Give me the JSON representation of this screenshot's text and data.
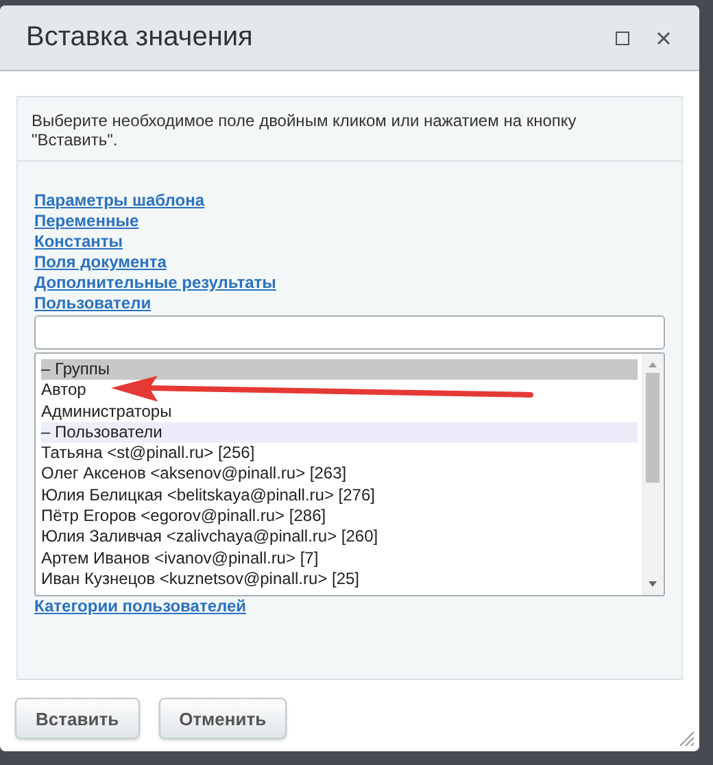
{
  "window": {
    "title": "Вставка значения"
  },
  "hint": "Выберите необходимое поле двойным кликом или нажатием на кнопку \"Вставить\".",
  "sections_above": [
    "Параметры шаблона",
    "Переменные",
    "Константы",
    "Поля документа",
    "Дополнительные результаты",
    "Пользователи"
  ],
  "list": [
    {
      "kind": "group",
      "label": "– Группы",
      "selected": true
    },
    {
      "kind": "option",
      "label": "Автор",
      "selected": false
    },
    {
      "kind": "option",
      "label": "Администраторы",
      "selected": false
    },
    {
      "kind": "group",
      "label": "– Пользователи",
      "selected": false
    },
    {
      "kind": "option",
      "label": "Татьяна <st@pinall.ru> [256]",
      "selected": false
    },
    {
      "kind": "option",
      "label": "Олег Аксенов <aksenov@pinall.ru> [263]",
      "selected": false
    },
    {
      "kind": "option",
      "label": "Юлия Белицкая <belitskaya@pinall.ru> [276]",
      "selected": false
    },
    {
      "kind": "option",
      "label": "Пётр Егоров <egorov@pinall.ru> [286]",
      "selected": false
    },
    {
      "kind": "option",
      "label": "Юлия Заливчая <zalivchaya@pinall.ru> [260]",
      "selected": false
    },
    {
      "kind": "option",
      "label": "Артем Иванов <ivanov@pinall.ru> [7]",
      "selected": false
    },
    {
      "kind": "option",
      "label": "Иван Кузнецов <kuznetsov@pinall.ru> [25]",
      "selected": false
    }
  ],
  "sections_below": [
    "Категории пользователей"
  ],
  "buttons": [
    "Вставить",
    "Отменить"
  ]
}
